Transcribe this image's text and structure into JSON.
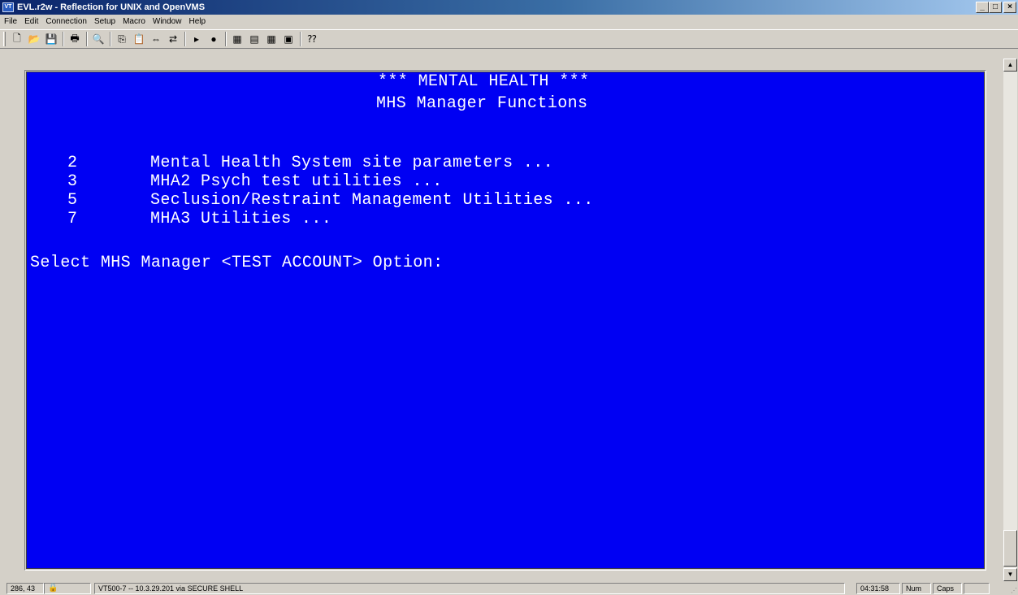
{
  "window": {
    "title": "EVL.r2w - Reflection for UNIX and OpenVMS",
    "icon_label": "VT",
    "controls": {
      "minimize": "_",
      "maximize": "□",
      "close": "×"
    }
  },
  "menu": [
    "File",
    "Edit",
    "Connection",
    "Setup",
    "Macro",
    "Window",
    "Help"
  ],
  "toolbar": {
    "icons": [
      {
        "name": "new-icon",
        "glyph": "🗋"
      },
      {
        "name": "open-icon",
        "glyph": "📂"
      },
      {
        "name": "save-icon",
        "glyph": "💾"
      },
      {
        "name": "print-icon",
        "glyph": "🖶"
      },
      {
        "name": "find-icon",
        "glyph": "🔍"
      },
      {
        "name": "copy-icon",
        "glyph": "⎘"
      },
      {
        "name": "paste-icon",
        "glyph": "📋"
      },
      {
        "name": "connect-icon",
        "glyph": "⇔"
      },
      {
        "name": "transfer-icon",
        "glyph": "⇄"
      },
      {
        "name": "play-macro-icon",
        "glyph": "▸"
      },
      {
        "name": "record-macro-icon",
        "glyph": "●"
      },
      {
        "name": "settings-icon",
        "glyph": "▦"
      },
      {
        "name": "display-icon",
        "glyph": "▤"
      },
      {
        "name": "keyboard-icon",
        "glyph": "▦"
      },
      {
        "name": "options-icon",
        "glyph": "▣"
      },
      {
        "name": "context-help-icon",
        "glyph": "⁇"
      }
    ]
  },
  "terminal": {
    "bg_color": "#0000f3",
    "fg_color": "#ffffff",
    "header1": "*** MENTAL HEALTH ***",
    "header2": "MHS Manager Functions",
    "options": [
      {
        "num": "2",
        "label": "Mental Health System site parameters ..."
      },
      {
        "num": "3",
        "label": "MHA2 Psych test utilities ..."
      },
      {
        "num": "5",
        "label": "Seclusion/Restraint Management Utilities ..."
      },
      {
        "num": "7",
        "label": "MHA3 Utilities ..."
      }
    ],
    "prompt": "Select MHS Manager <TEST ACCOUNT> Option:"
  },
  "status": {
    "cursor": "286, 43",
    "lock_icon": "lock-icon",
    "connection": "VT500-7 -- 10.3.29.201 via SECURE SHELL",
    "time": "04:31:58",
    "num": "Num",
    "caps": "Caps"
  }
}
